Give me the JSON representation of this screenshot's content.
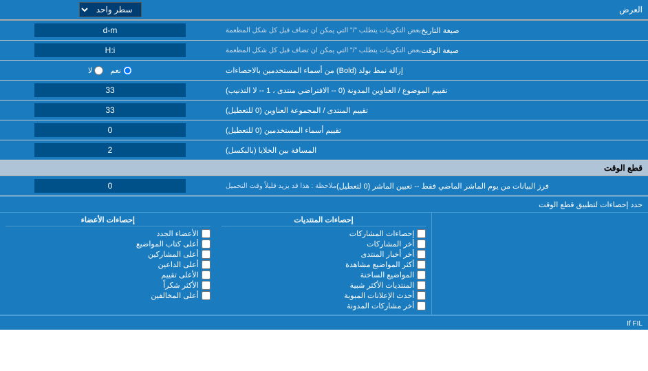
{
  "header": {
    "label": "العرض",
    "control_label": "سطر واحد"
  },
  "rows": [
    {
      "id": "date-format",
      "label": "صيغة التاريخ",
      "sublabel": "بعض التكوينات يتطلب \"/\" التي يمكن ان تضاف قبل كل شكل المطعمة",
      "value": "d-m"
    },
    {
      "id": "time-format",
      "label": "صيغة الوقت",
      "sublabel": "بعض التكوينات يتطلب \"/\" التي يمكن ان تضاف قبل كل شكل المطعمة",
      "value": "H:i"
    },
    {
      "id": "bold-remove",
      "label": "إزالة نمط بولد (Bold) من أسماء المستخدمين بالاحصاءات",
      "type": "radio",
      "options": [
        {
          "value": "yes",
          "label": "نعم",
          "checked": true
        },
        {
          "value": "no",
          "label": "لا",
          "checked": false
        }
      ]
    },
    {
      "id": "topic-sort",
      "label": "تقييم الموضوع / العناوين المدونة (0 -- الافتراضي منتدى ، 1 -- لا التذنيب)",
      "value": "33"
    },
    {
      "id": "forum-sort",
      "label": "تقييم المنتدى / المجموعة العناوين (0 للتعطيل)",
      "value": "33"
    },
    {
      "id": "user-sort",
      "label": "تقييم أسماء المستخدمين (0 للتعطيل)",
      "value": "0"
    },
    {
      "id": "cell-spacing",
      "label": "المسافة بين الخلايا (بالبكسل)",
      "value": "2"
    }
  ],
  "section_realtime": {
    "title": "قطع الوقت"
  },
  "realtime_row": {
    "label": "فرز البيانات من يوم الماشر الماضي فقط -- تعيين الماشر (0 لتعطيل)",
    "sublabel": "ملاحظة : هذا قد يزيد قليلاً وقت التحميل",
    "value": "0"
  },
  "stats_apply": {
    "label": "حدد إحصاءات لتطبيق قطع الوقت"
  },
  "stats_columns": [
    {
      "id": "col1",
      "header": "",
      "items": []
    },
    {
      "id": "col-posts",
      "header": "إحصاءات المنتديات",
      "items": [
        "إحصاءات المشاركات",
        "أخر المشاركات",
        "أخر أخبار المنتدى",
        "أكثر المواضيع مشاهدة",
        "المواضيع الساخنة",
        "المنتديات الأكثر شبية",
        "أحدث الإعلانات المبوبة",
        "أخر مشاركات المدونة"
      ]
    },
    {
      "id": "col-members",
      "header": "إحصاءات الأعضاء",
      "items": [
        "الأعضاء الجدد",
        "أعلى كتاب المواضيع",
        "أعلى المشاركين",
        "أعلى الداعين",
        "الأعلى تقييم",
        "الأكثر شكراً",
        "أعلى المخالفين"
      ]
    }
  ]
}
